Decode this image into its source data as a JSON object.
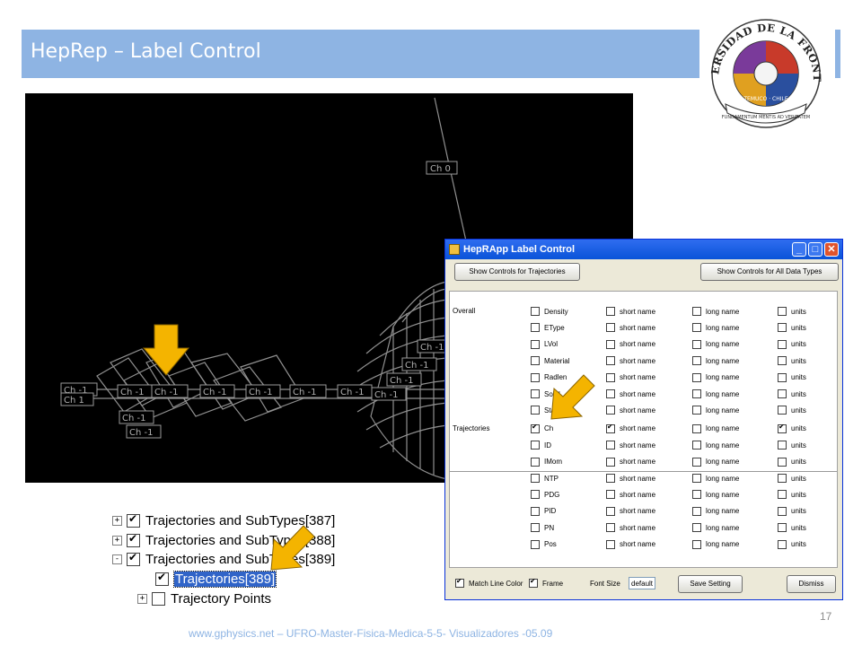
{
  "slide": {
    "title": "HepRep – Label Control",
    "footer": "www.gphysics.net – UFRO-Master-Fisica-Medica-5-5- Visualizadores -05.09",
    "page_number": "17",
    "accent_color": "#8eb4e3"
  },
  "logo": {
    "arc_text": "UNIVERSIDAD DE LA FRONTERA",
    "city": "TEMUCO · CHILE",
    "motto": "FUNDAMENTUM MENTIS AD VERITATEM"
  },
  "viewer": {
    "labels": [
      "Ch 0",
      "Ch -1",
      "Ch 1",
      "Ch -1",
      "Ch -1",
      "Ch -1",
      "Ch -1",
      "Ch -1",
      "Ch -1",
      "Ch -1",
      "Ch -1",
      "Ch -1",
      "Ch -1",
      "Ch -1",
      "Ch -1"
    ]
  },
  "tree": {
    "rows": [
      {
        "expander": "+",
        "checked": true,
        "label": "Trajectories and SubTypes[387]"
      },
      {
        "expander": "+",
        "checked": true,
        "label": "Trajectories and SubTypes[388]"
      },
      {
        "expander": "-",
        "checked": true,
        "label": "Trajectories and SubTypes[389]"
      },
      {
        "expander": "",
        "checked": true,
        "label": "Trajectories[389]",
        "selected": true
      },
      {
        "expander": "+",
        "checked": false,
        "label": "Trajectory Points"
      }
    ]
  },
  "dialog": {
    "title": "HepRApp Label Control",
    "window_buttons": [
      "_",
      "□",
      "✕"
    ],
    "show_trajectories": "Show Controls for Trajectories",
    "show_all": "Show Controls for All Data Types",
    "column_labels": {
      "short": "short name",
      "long": "long name",
      "units": "units"
    },
    "groups": [
      {
        "name": "Overall",
        "attrs": [
          {
            "attr": "Density",
            "c": [
              false,
              false,
              false,
              false
            ]
          },
          {
            "attr": "EType",
            "c": [
              false,
              false,
              false,
              false
            ]
          },
          {
            "attr": "LVol",
            "c": [
              false,
              false,
              false,
              false
            ]
          },
          {
            "attr": "Material",
            "c": [
              false,
              false,
              false,
              false
            ]
          },
          {
            "attr": "Radlen",
            "c": [
              false,
              false,
              false,
              false
            ]
          },
          {
            "attr": "Solid",
            "c": [
              false,
              false,
              false,
              false
            ]
          },
          {
            "attr": "State",
            "c": [
              false,
              false,
              false,
              false
            ]
          }
        ]
      },
      {
        "name": "Trajectories",
        "attrs": [
          {
            "attr": "Ch",
            "c": [
              true,
              true,
              false,
              true
            ]
          },
          {
            "attr": "ID",
            "c": [
              false,
              false,
              false,
              false
            ]
          },
          {
            "attr": "IMom",
            "c": [
              false,
              false,
              false,
              false
            ]
          },
          {
            "attr": "NTP",
            "c": [
              false,
              false,
              false,
              false
            ]
          },
          {
            "attr": "PDG",
            "c": [
              false,
              false,
              false,
              false
            ]
          },
          {
            "attr": "PID",
            "c": [
              false,
              false,
              false,
              false
            ]
          },
          {
            "attr": "PN",
            "c": [
              false,
              false,
              false,
              false
            ]
          },
          {
            "attr": "Pos",
            "c": [
              false,
              false,
              false,
              false
            ]
          }
        ]
      }
    ],
    "match_line_color": "Match Line Color",
    "frame": "Frame",
    "font_size_label": "Font Size",
    "font_size_value": "default",
    "save_setting": "Save Setting",
    "dismiss": "Dismiss"
  }
}
